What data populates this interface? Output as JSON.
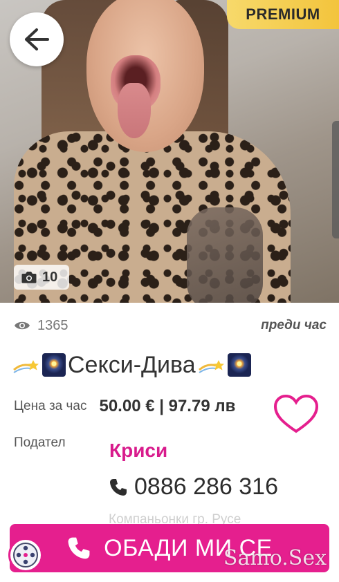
{
  "header": {
    "badge": "PREMIUM",
    "photo_count": "10"
  },
  "meta": {
    "views": "1365",
    "posted": "преди час"
  },
  "listing": {
    "title": "Секси-Дива",
    "price_label": "Цена за час",
    "price_value": "50.00 € | 97.79 лв",
    "seller_label": "Подател",
    "seller_name": "Криси",
    "phone": "0886 286 316",
    "location": "Компаньонки гр. Русе"
  },
  "cta": {
    "call_label": "ОБАДИ МИ СЕ"
  },
  "watermark": "Samo.Sex",
  "colors": {
    "accent": "#e51f8e",
    "seller": "#d81b8c",
    "premium": "#f3c43c"
  },
  "icons": {
    "back": "arrow-left-icon",
    "camera": "camera-icon",
    "views": "eye-icon",
    "favorite": "heart-outline-icon",
    "phone": "phone-icon",
    "compass": "compass-icon"
  }
}
